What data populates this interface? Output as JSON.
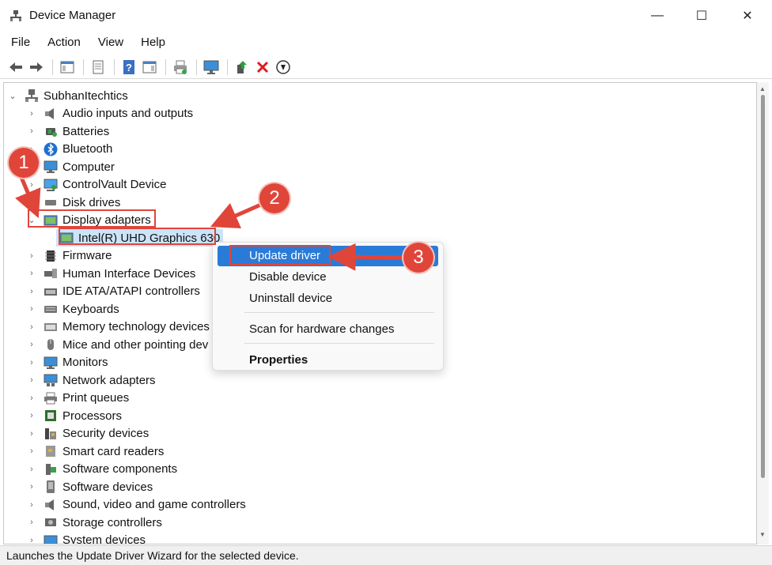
{
  "window": {
    "title": "Device Manager",
    "minimize": "—",
    "maximize": "☐",
    "close": "✕"
  },
  "menu": [
    "File",
    "Action",
    "View",
    "Help"
  ],
  "tree": {
    "root": "SubhanItechtics",
    "categories": [
      {
        "label": "Audio inputs and outputs",
        "icon": "speaker-icon",
        "expanded": false
      },
      {
        "label": "Batteries",
        "icon": "battery-icon",
        "expanded": false
      },
      {
        "label": "Bluetooth",
        "icon": "bluetooth-icon",
        "expanded": false
      },
      {
        "label": "Computer",
        "icon": "monitor-icon",
        "expanded": false
      },
      {
        "label": "ControlVault Device",
        "icon": "controlvault-icon",
        "expanded": false
      },
      {
        "label": "Disk drives",
        "icon": "disk-icon",
        "expanded": false
      },
      {
        "label": "Display adapters",
        "icon": "display-adapter-icon",
        "expanded": true
      },
      {
        "label": "Intel(R) UHD Graphics 630",
        "icon": "display-adapter-icon",
        "child": true
      },
      {
        "label": "Firmware",
        "icon": "chip-icon",
        "expanded": false
      },
      {
        "label": "Human Interface Devices",
        "icon": "hid-icon",
        "expanded": false
      },
      {
        "label": "IDE ATA/ATAPI controllers",
        "icon": "ide-icon",
        "expanded": false
      },
      {
        "label": "Keyboards",
        "icon": "keyboard-icon",
        "expanded": false
      },
      {
        "label": "Memory technology devices",
        "icon": "memory-icon",
        "expanded": false
      },
      {
        "label": "Mice and other pointing dev",
        "icon": "mouse-icon",
        "expanded": false
      },
      {
        "label": "Monitors",
        "icon": "monitor-icon",
        "expanded": false
      },
      {
        "label": "Network adapters",
        "icon": "network-icon",
        "expanded": false
      },
      {
        "label": "Print queues",
        "icon": "printer-icon",
        "expanded": false
      },
      {
        "label": "Processors",
        "icon": "processor-icon",
        "expanded": false
      },
      {
        "label": "Security devices",
        "icon": "security-icon",
        "expanded": false
      },
      {
        "label": "Smart card readers",
        "icon": "smartcard-icon",
        "expanded": false
      },
      {
        "label": "Software components",
        "icon": "software-component-icon",
        "expanded": false
      },
      {
        "label": "Software devices",
        "icon": "software-device-icon",
        "expanded": false
      },
      {
        "label": "Sound, video and game controllers",
        "icon": "speaker-icon",
        "expanded": false
      },
      {
        "label": "Storage controllers",
        "icon": "storage-icon",
        "expanded": false
      },
      {
        "label": "System devices",
        "icon": "system-icon",
        "expanded": false
      }
    ]
  },
  "context_menu": {
    "items": [
      "Update driver",
      "Disable device",
      "Uninstall device",
      "Scan for hardware changes",
      "Properties"
    ]
  },
  "annotations": {
    "one": "1",
    "two": "2",
    "three": "3"
  },
  "status": "Launches the Update Driver Wizard for the selected device.",
  "colors": {
    "accent": "#2a7bd8",
    "annotation": "#e0453a",
    "selection": "#cce4f7"
  }
}
